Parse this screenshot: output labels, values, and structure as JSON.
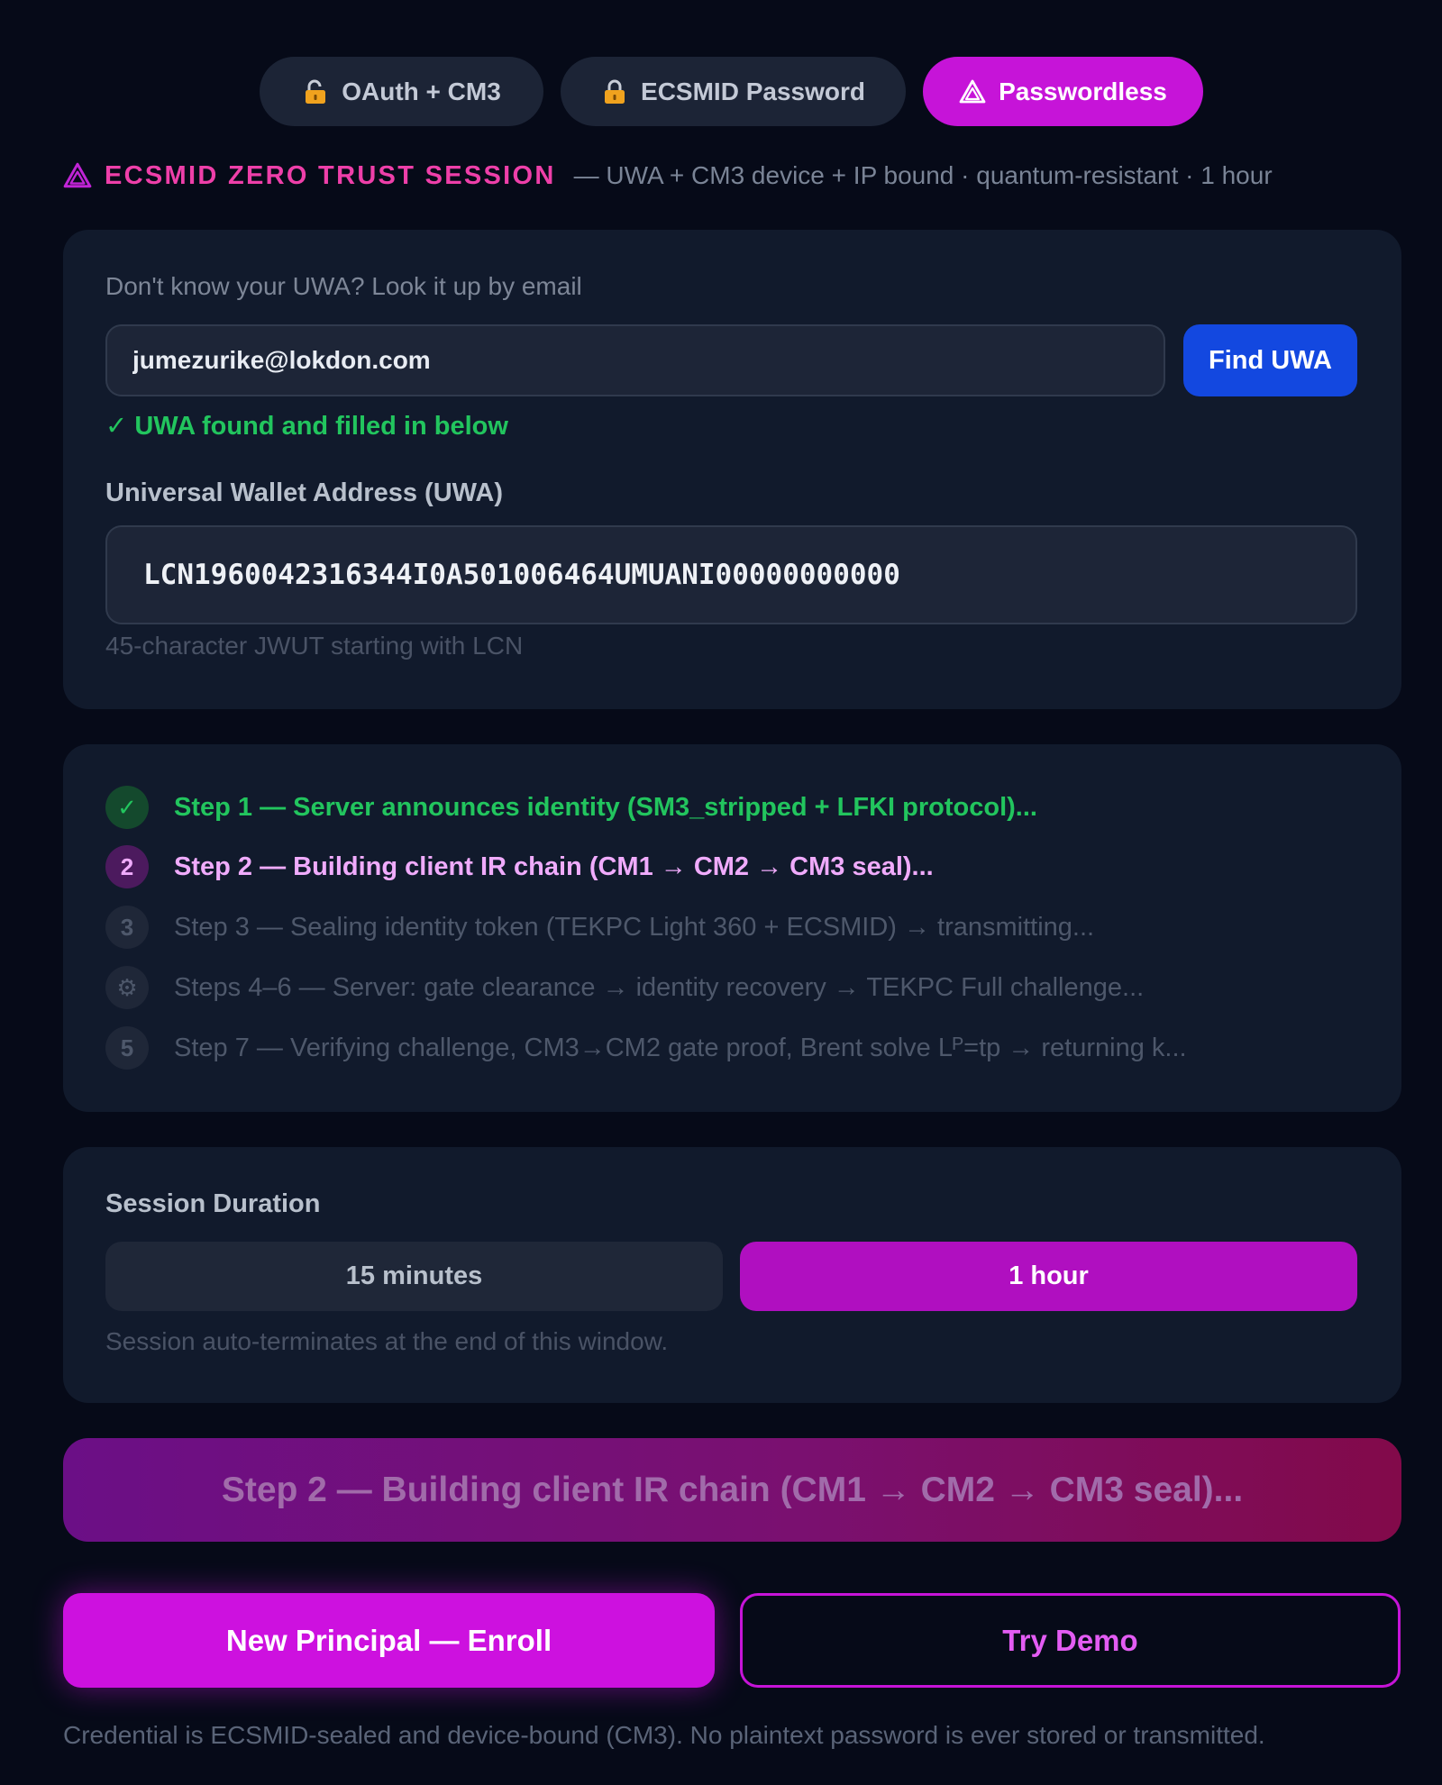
{
  "tabs": [
    {
      "label": "OAuth + CM3",
      "icon": "unlock-icon"
    },
    {
      "label": "ECSMID Password",
      "icon": "lock-icon"
    },
    {
      "label": "Passwordless",
      "icon": "warning-triangle-icon",
      "active": true
    }
  ],
  "session_header": {
    "title": "ECSMID ZERO TRUST SESSION",
    "subtitle": "— UWA + CM3 device + IP bound · quantum-resistant · 1 hour"
  },
  "lookup": {
    "label": "Don't know your UWA? Look it up by email",
    "email_value": "jumezurike@lokdon.com",
    "button_label": "Find UWA",
    "status": "✓ UWA found and filled in below"
  },
  "uwa": {
    "label": "Universal Wallet Address (UWA)",
    "value": "LCN1960042316344I0A501006464UMUANI00000000000",
    "hint": "45-character JWUT starting with LCN"
  },
  "steps": [
    {
      "badge": "✓",
      "state": "done",
      "text": "Step 1 — Server announces identity (SM3_stripped + LFKI protocol)..."
    },
    {
      "badge": "2",
      "state": "active",
      "text": "Step 2 — Building client IR chain (CM1 → CM2 → CM3 seal)..."
    },
    {
      "badge": "3",
      "state": "pending",
      "text": "Step 3 — Sealing identity token (TEKPC Light 360 + ECSMID) → transmitting..."
    },
    {
      "badge": "⚙",
      "state": "pending",
      "text": "Steps 4–6 — Server: gate clearance → identity recovery → TEKPC Full challenge..."
    },
    {
      "badge": "5",
      "state": "pending",
      "text": "Step 7 — Verifying challenge, CM3→CM2 gate proof, Brent solve Lᴾ=tp → returning k..."
    }
  ],
  "duration": {
    "label": "Session Duration",
    "options": [
      "15 minutes",
      "1 hour"
    ],
    "selected": "1 hour",
    "hint": "Session auto-terminates at the end of this window."
  },
  "progress_banner": "Step 2 — Building client IR chain (CM1 → CM2 → CM3 seal)...",
  "actions": {
    "enroll": "New Principal — Enroll",
    "demo": "Try Demo"
  },
  "footer": "Credential is ECSMID-sealed and device-bound (CM3). No plaintext password is ever stored or transmitted.",
  "colors": {
    "background": "#060a18",
    "accent_magenta": "#c614d8",
    "success_green": "#22c55e",
    "primary_blue": "#1348e0",
    "header_pink": "#ee3fa9"
  }
}
